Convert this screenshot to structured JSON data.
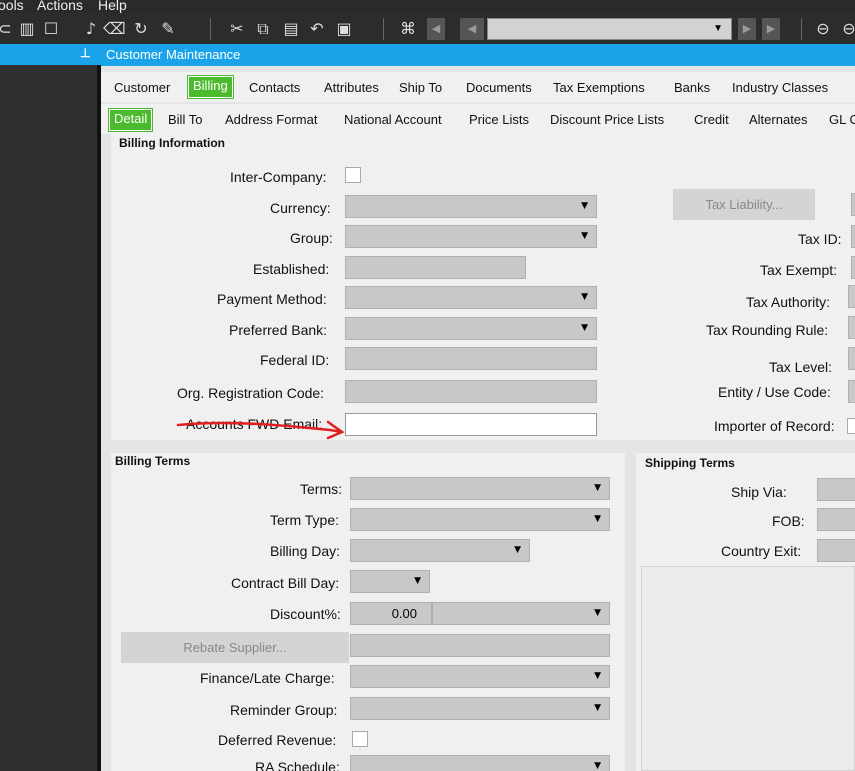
{
  "menu": {
    "items": [
      "ools",
      "Actions",
      "Help"
    ]
  },
  "toolbar": {
    "icons": [
      "book-icon",
      "note-icon",
      "pen-icon",
      "trash-icon",
      "refresh-icon",
      "paint-icon",
      "cut-icon",
      "copy-icon",
      "paste-icon",
      "undo-icon",
      "clipboard-icon",
      "binoculars-icon"
    ],
    "nav_combo_value": ""
  },
  "window": {
    "title": "Customer Maintenance"
  },
  "tabs": [
    "Customer",
    "Billing",
    "Contacts",
    "Attributes",
    "Ship To",
    "Documents",
    "Tax Exemptions",
    "Banks",
    "Industry Classes"
  ],
  "active_tab": "Billing",
  "subtabs": [
    "Detail",
    "Bill To",
    "Address Format",
    "National Account",
    "Price Lists",
    "Discount Price Lists",
    "Credit",
    "Alternates",
    "GL C"
  ],
  "active_subtab": "Detail",
  "billing_info": {
    "title": "Billing Information",
    "labels": {
      "inter_company": "Inter-Company:",
      "currency": "Currency:",
      "group": "Group:",
      "established": "Established:",
      "payment_method": "Payment Method:",
      "preferred_bank": "Preferred Bank:",
      "federal_id": "Federal ID:",
      "org_reg": "Org. Registration Code:",
      "accounts_fwd_email": "Accounts FWD Email:"
    },
    "tax": {
      "liability_button": "Tax Liability...",
      "tax_id": "Tax ID:",
      "tax_exempt": "Tax Exempt:",
      "tax_authority": "Tax Authority:",
      "tax_rounding": "Tax Rounding Rule:",
      "tax_level": "Tax Level:",
      "entity_use": "Entity / Use Code:",
      "importer": "Importer of Record:"
    }
  },
  "billing_terms": {
    "title": "Billing Terms",
    "labels": {
      "terms": "Terms:",
      "term_type": "Term Type:",
      "billing_day": "Billing Day:",
      "contract_bill_day": "Contract Bill Day:",
      "discount": "Discount%:",
      "finance": "Finance/Late Charge:",
      "reminder": "Reminder Group:",
      "deferred": "Deferred Revenue:",
      "ra_schedule": "RA Schedule:"
    },
    "discount_value": "0.00",
    "rebate_button": "Rebate Supplier..."
  },
  "shipping_terms": {
    "title": "Shipping Terms",
    "labels": {
      "ship_via": "Ship Via:",
      "fob": "FOB:",
      "country_exit": "Country Exit:"
    }
  },
  "colors": {
    "accent": "#1aa3e8",
    "active_tab": "#4cba2d",
    "annotation": "#e02020"
  }
}
